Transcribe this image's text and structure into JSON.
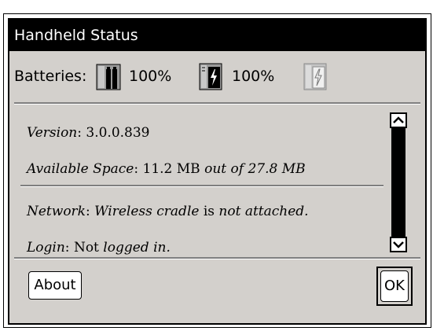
{
  "window": {
    "title": "Handheld Status"
  },
  "batteries": {
    "label": "Batteries:",
    "items": [
      {
        "icon": "aaa-battery-icon",
        "percent": "100%"
      },
      {
        "icon": "rechargeable-battery-icon",
        "percent": "100%"
      },
      {
        "icon": "rechargeable-battery-inactive-icon"
      }
    ]
  },
  "info": {
    "version": {
      "label": "Version",
      "value": "3.0.0.839"
    },
    "space": {
      "label": "Available Space",
      "sep": ":",
      "value": "11.2 MB",
      "mid": "out of",
      "total": "27.8 MB"
    },
    "network": {
      "label": "Network",
      "subject": "Wireless cradle",
      "verb": "is",
      "status": "not attached."
    },
    "login": {
      "label": "Login",
      "value": "Not",
      "status": "logged in."
    }
  },
  "buttons": {
    "about": "About",
    "ok": "OK"
  }
}
